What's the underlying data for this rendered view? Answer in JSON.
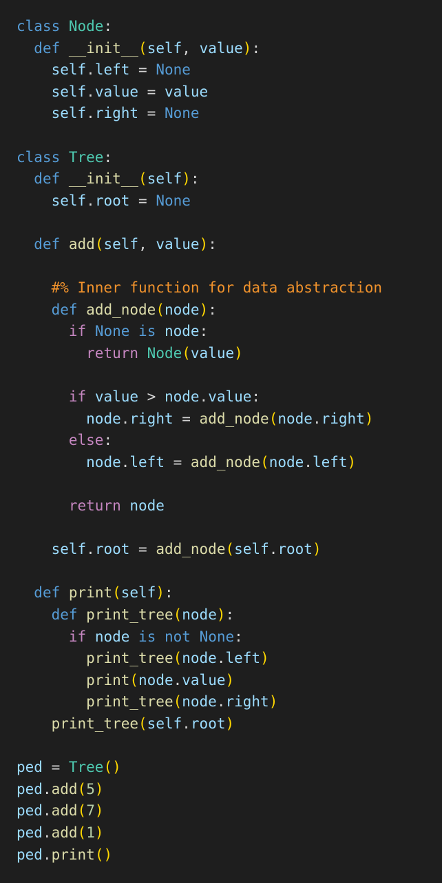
{
  "editor": {
    "background": "#1e1e1e",
    "token_colors": {
      "keyword": "#569cd6",
      "class_name": "#4ec9b0",
      "function": "#dcdcaa",
      "variable": "#9cdcfe",
      "control": "#c586c0",
      "comment": "#f0922c",
      "number": "#b5cea8",
      "bracket_level_1": "#ffd700",
      "bracket_level_2": "#da70d6",
      "bracket_level_3": "#179fff",
      "plain": "#d4d4d4"
    },
    "lines": [
      [
        [
          "class",
          "kw"
        ],
        [
          " ",
          "pl"
        ],
        [
          "Node",
          "cls"
        ],
        [
          ":",
          "pl"
        ]
      ],
      [
        [
          "  ",
          "pl"
        ],
        [
          "def",
          "kw"
        ],
        [
          " ",
          "pl"
        ],
        [
          "__init__",
          "fn"
        ],
        [
          "(",
          "b1"
        ],
        [
          "self",
          "var"
        ],
        [
          ", ",
          "pl"
        ],
        [
          "value",
          "var"
        ],
        [
          ")",
          "b1"
        ],
        [
          ":",
          "pl"
        ]
      ],
      [
        [
          "    ",
          "pl"
        ],
        [
          "self",
          "var"
        ],
        [
          ".",
          "pl"
        ],
        [
          "left",
          "var"
        ],
        [
          " = ",
          "op"
        ],
        [
          "None",
          "kw"
        ]
      ],
      [
        [
          "    ",
          "pl"
        ],
        [
          "self",
          "var"
        ],
        [
          ".",
          "pl"
        ],
        [
          "value",
          "var"
        ],
        [
          " = ",
          "op"
        ],
        [
          "value",
          "var"
        ]
      ],
      [
        [
          "    ",
          "pl"
        ],
        [
          "self",
          "var"
        ],
        [
          ".",
          "pl"
        ],
        [
          "right",
          "var"
        ],
        [
          " = ",
          "op"
        ],
        [
          "None",
          "kw"
        ]
      ],
      [],
      [
        [
          "class",
          "kw"
        ],
        [
          " ",
          "pl"
        ],
        [
          "Tree",
          "cls"
        ],
        [
          ":",
          "pl"
        ]
      ],
      [
        [
          "  ",
          "pl"
        ],
        [
          "def",
          "kw"
        ],
        [
          " ",
          "pl"
        ],
        [
          "__init__",
          "fn"
        ],
        [
          "(",
          "b1"
        ],
        [
          "self",
          "var"
        ],
        [
          ")",
          "b1"
        ],
        [
          ":",
          "pl"
        ]
      ],
      [
        [
          "    ",
          "pl"
        ],
        [
          "self",
          "var"
        ],
        [
          ".",
          "pl"
        ],
        [
          "root",
          "var"
        ],
        [
          " = ",
          "op"
        ],
        [
          "None",
          "kw"
        ]
      ],
      [],
      [
        [
          "  ",
          "pl"
        ],
        [
          "def",
          "kw"
        ],
        [
          " ",
          "pl"
        ],
        [
          "add",
          "fn"
        ],
        [
          "(",
          "b1"
        ],
        [
          "self",
          "var"
        ],
        [
          ", ",
          "pl"
        ],
        [
          "value",
          "var"
        ],
        [
          ")",
          "b1"
        ],
        [
          ":",
          "pl"
        ]
      ],
      [],
      [
        [
          "    ",
          "pl"
        ],
        [
          "#% Inner function for data abstraction",
          "cmt"
        ]
      ],
      [
        [
          "    ",
          "pl"
        ],
        [
          "def",
          "kw"
        ],
        [
          " ",
          "pl"
        ],
        [
          "add_node",
          "fn"
        ],
        [
          "(",
          "b1"
        ],
        [
          "node",
          "var"
        ],
        [
          ")",
          "b1"
        ],
        [
          ":",
          "pl"
        ]
      ],
      [
        [
          "      ",
          "pl"
        ],
        [
          "if",
          "ctl"
        ],
        [
          " ",
          "pl"
        ],
        [
          "None",
          "kw"
        ],
        [
          " ",
          "pl"
        ],
        [
          "is",
          "kw"
        ],
        [
          " ",
          "pl"
        ],
        [
          "node",
          "var"
        ],
        [
          ":",
          "pl"
        ]
      ],
      [
        [
          "        ",
          "pl"
        ],
        [
          "return",
          "ctl"
        ],
        [
          " ",
          "pl"
        ],
        [
          "Node",
          "cls"
        ],
        [
          "(",
          "b1"
        ],
        [
          "value",
          "var"
        ],
        [
          ")",
          "b1"
        ]
      ],
      [],
      [
        [
          "      ",
          "pl"
        ],
        [
          "if",
          "ctl"
        ],
        [
          " ",
          "pl"
        ],
        [
          "value",
          "var"
        ],
        [
          " > ",
          "op"
        ],
        [
          "node",
          "var"
        ],
        [
          ".",
          "pl"
        ],
        [
          "value",
          "var"
        ],
        [
          ":",
          "pl"
        ]
      ],
      [
        [
          "        ",
          "pl"
        ],
        [
          "node",
          "var"
        ],
        [
          ".",
          "pl"
        ],
        [
          "right",
          "var"
        ],
        [
          " = ",
          "op"
        ],
        [
          "add_node",
          "fn"
        ],
        [
          "(",
          "b1"
        ],
        [
          "node",
          "var"
        ],
        [
          ".",
          "pl"
        ],
        [
          "right",
          "var"
        ],
        [
          ")",
          "b1"
        ]
      ],
      [
        [
          "      ",
          "pl"
        ],
        [
          "else",
          "ctl"
        ],
        [
          ":",
          "pl"
        ]
      ],
      [
        [
          "        ",
          "pl"
        ],
        [
          "node",
          "var"
        ],
        [
          ".",
          "pl"
        ],
        [
          "left",
          "var"
        ],
        [
          " = ",
          "op"
        ],
        [
          "add_node",
          "fn"
        ],
        [
          "(",
          "b1"
        ],
        [
          "node",
          "var"
        ],
        [
          ".",
          "pl"
        ],
        [
          "left",
          "var"
        ],
        [
          ")",
          "b1"
        ]
      ],
      [],
      [
        [
          "      ",
          "pl"
        ],
        [
          "return",
          "ctl"
        ],
        [
          " ",
          "pl"
        ],
        [
          "node",
          "var"
        ]
      ],
      [],
      [
        [
          "    ",
          "pl"
        ],
        [
          "self",
          "var"
        ],
        [
          ".",
          "pl"
        ],
        [
          "root",
          "var"
        ],
        [
          " = ",
          "op"
        ],
        [
          "add_node",
          "fn"
        ],
        [
          "(",
          "b1"
        ],
        [
          "self",
          "var"
        ],
        [
          ".",
          "pl"
        ],
        [
          "root",
          "var"
        ],
        [
          ")",
          "b1"
        ]
      ],
      [],
      [
        [
          "  ",
          "pl"
        ],
        [
          "def",
          "kw"
        ],
        [
          " ",
          "pl"
        ],
        [
          "print",
          "fn"
        ],
        [
          "(",
          "b1"
        ],
        [
          "self",
          "var"
        ],
        [
          ")",
          "b1"
        ],
        [
          ":",
          "pl"
        ]
      ],
      [
        [
          "    ",
          "pl"
        ],
        [
          "def",
          "kw"
        ],
        [
          " ",
          "pl"
        ],
        [
          "print_tree",
          "fn"
        ],
        [
          "(",
          "b1"
        ],
        [
          "node",
          "var"
        ],
        [
          ")",
          "b1"
        ],
        [
          ":",
          "pl"
        ]
      ],
      [
        [
          "      ",
          "pl"
        ],
        [
          "if",
          "ctl"
        ],
        [
          " ",
          "pl"
        ],
        [
          "node",
          "var"
        ],
        [
          " ",
          "pl"
        ],
        [
          "is",
          "kw"
        ],
        [
          " ",
          "pl"
        ],
        [
          "not",
          "kw"
        ],
        [
          " ",
          "pl"
        ],
        [
          "None",
          "kw"
        ],
        [
          ":",
          "pl"
        ]
      ],
      [
        [
          "        ",
          "pl"
        ],
        [
          "print_tree",
          "fn"
        ],
        [
          "(",
          "b1"
        ],
        [
          "node",
          "var"
        ],
        [
          ".",
          "pl"
        ],
        [
          "left",
          "var"
        ],
        [
          ")",
          "b1"
        ]
      ],
      [
        [
          "        ",
          "pl"
        ],
        [
          "print",
          "fn"
        ],
        [
          "(",
          "b1"
        ],
        [
          "node",
          "var"
        ],
        [
          ".",
          "pl"
        ],
        [
          "value",
          "var"
        ],
        [
          ")",
          "b1"
        ]
      ],
      [
        [
          "        ",
          "pl"
        ],
        [
          "print_tree",
          "fn"
        ],
        [
          "(",
          "b1"
        ],
        [
          "node",
          "var"
        ],
        [
          ".",
          "pl"
        ],
        [
          "right",
          "var"
        ],
        [
          ")",
          "b1"
        ]
      ],
      [
        [
          "    ",
          "pl"
        ],
        [
          "print_tree",
          "fn"
        ],
        [
          "(",
          "b1"
        ],
        [
          "self",
          "var"
        ],
        [
          ".",
          "pl"
        ],
        [
          "root",
          "var"
        ],
        [
          ")",
          "b1"
        ]
      ],
      [],
      [
        [
          "ped",
          "var"
        ],
        [
          " = ",
          "op"
        ],
        [
          "Tree",
          "cls"
        ],
        [
          "(",
          "b1"
        ],
        [
          ")",
          "b1"
        ]
      ],
      [
        [
          "ped",
          "var"
        ],
        [
          ".",
          "pl"
        ],
        [
          "add",
          "fn"
        ],
        [
          "(",
          "b1"
        ],
        [
          "5",
          "num"
        ],
        [
          ")",
          "b1"
        ]
      ],
      [
        [
          "ped",
          "var"
        ],
        [
          ".",
          "pl"
        ],
        [
          "add",
          "fn"
        ],
        [
          "(",
          "b1"
        ],
        [
          "7",
          "num"
        ],
        [
          ")",
          "b1"
        ]
      ],
      [
        [
          "ped",
          "var"
        ],
        [
          ".",
          "pl"
        ],
        [
          "add",
          "fn"
        ],
        [
          "(",
          "b1"
        ],
        [
          "1",
          "num"
        ],
        [
          ")",
          "b1"
        ]
      ],
      [
        [
          "ped",
          "var"
        ],
        [
          ".",
          "pl"
        ],
        [
          "print",
          "fn"
        ],
        [
          "(",
          "b1"
        ],
        [
          ")",
          "b1"
        ]
      ]
    ]
  }
}
